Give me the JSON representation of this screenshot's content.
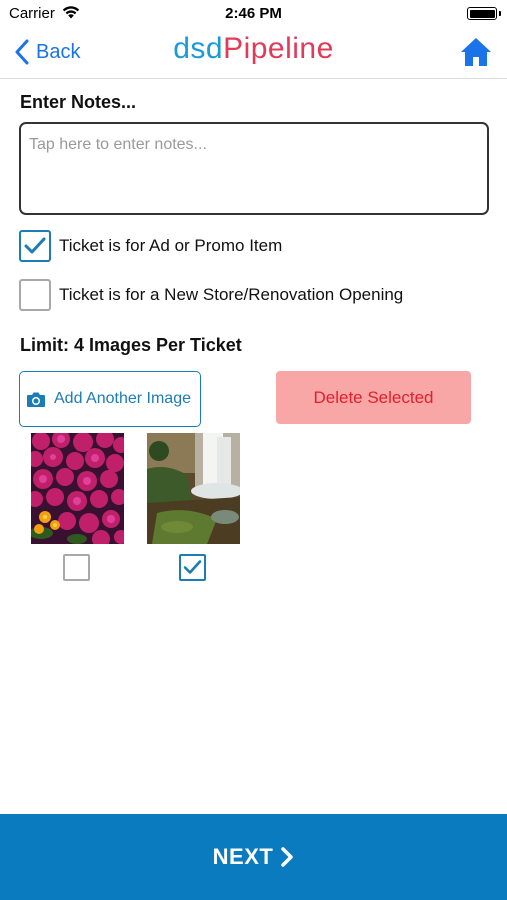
{
  "status_bar": {
    "carrier": "Carrier",
    "time": "2:46 PM",
    "icons": [
      "wifi-icon",
      "battery-icon"
    ]
  },
  "nav": {
    "back_label": "Back",
    "logo_part1": "dsd",
    "logo_part2": "Pipeline",
    "home_icon": "home-icon",
    "colors": {
      "accent": "#1a73e8",
      "logo_blue": "#1a9ad6",
      "logo_red": "#e23b5a"
    }
  },
  "notes": {
    "label": "Enter Notes...",
    "value": "",
    "placeholder": "Tap here to enter notes..."
  },
  "options": [
    {
      "label": "Ticket is for Ad or Promo Item",
      "checked": true
    },
    {
      "label": "Ticket is for a New Store/Renovation Opening",
      "checked": false
    }
  ],
  "images": {
    "limit_label": "Limit: 4 Images Per Ticket",
    "add_button": "Add Another Image",
    "delete_button": "Delete Selected",
    "items": [
      {
        "subject": "magenta flowers",
        "selected": false
      },
      {
        "subject": "waterfall",
        "selected": true
      }
    ],
    "colors": {
      "brand_blue": "#1c7cb5",
      "delete_bg": "#f9a6a6",
      "delete_text": "#e0202c"
    }
  },
  "footer": {
    "next_label": "NEXT",
    "background": "#0b7bbf"
  }
}
